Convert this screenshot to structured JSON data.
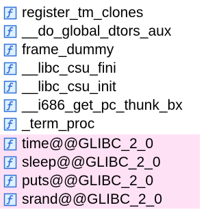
{
  "colors": {
    "imported_row_bg": "#ffe1f5",
    "icon_blue": "#2d6fd8",
    "icon_fill": "#dff0ff"
  },
  "functions": [
    {
      "name": "register_tm_clones",
      "icon": "function-icon",
      "imported": false
    },
    {
      "name": "__do_global_dtors_aux",
      "icon": "function-icon",
      "imported": false
    },
    {
      "name": "frame_dummy",
      "icon": "function-icon",
      "imported": false
    },
    {
      "name": "__libc_csu_fini",
      "icon": "function-icon",
      "imported": false
    },
    {
      "name": "__libc_csu_init",
      "icon": "function-icon",
      "imported": false
    },
    {
      "name": "__i686_get_pc_thunk_bx",
      "icon": "function-icon",
      "imported": false
    },
    {
      "name": "_term_proc",
      "icon": "function-icon",
      "imported": false
    },
    {
      "name": "time@@GLIBC_2_0",
      "icon": "function-icon",
      "imported": true
    },
    {
      "name": "sleep@@GLIBC_2_0",
      "icon": "function-icon",
      "imported": true
    },
    {
      "name": "puts@@GLIBC_2_0",
      "icon": "function-icon",
      "imported": true
    },
    {
      "name": "srand@@GLIBC_2_0",
      "icon": "function-icon",
      "imported": true
    }
  ]
}
